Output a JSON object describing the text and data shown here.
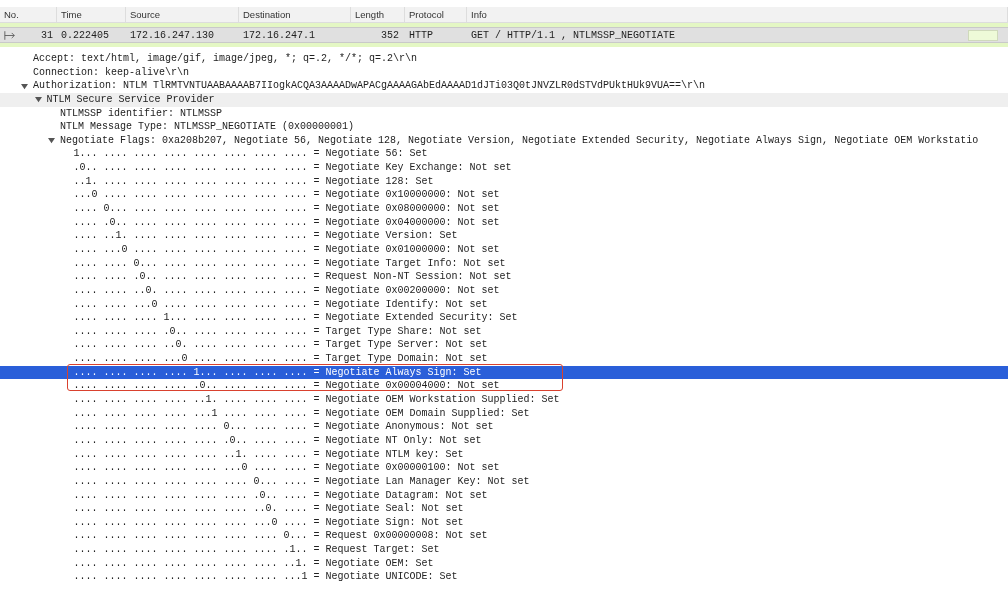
{
  "packet_list": {
    "columns": [
      "No.",
      "Time",
      "Source",
      "Destination",
      "Length",
      "Protocol",
      "Info"
    ],
    "rows": [
      {
        "no": "31",
        "time": "0.222405",
        "source": "172.16.247.130",
        "destination": "172.16.247.1",
        "length": "352",
        "protocol": "HTTP",
        "info": "GET / HTTP/1.1 , NTLMSSP_NEGOTIATE",
        "selected": true
      }
    ]
  },
  "details": {
    "items": [
      {
        "text": "Accept: text/html, image/gif, image/jpeg, *; q=.2, */*; q=.2\\r\\n",
        "selected": false
      },
      {
        "text": "Connection: keep-alive\\r\\n",
        "selected": false
      },
      {
        "text": "Authorization: NTLM TlRMTVNTUAABAAAAB7IIogkACQA3AAAADwAPACgAAAAGAbEdAAAAD1dJTi03Q0tJNVZLR0dSTVdPUktHUk9VUA==\\r\\n",
        "selected": false,
        "expanded": true,
        "children": [
          {
            "text": "NTLM Secure Service Provider",
            "selected": false,
            "shaded": true,
            "expanded": true,
            "children": [
              {
                "text": "NTLMSSP identifier: NTLMSSP",
                "selected": false
              },
              {
                "text": "NTLM Message Type: NTLMSSP_NEGOTIATE (0x00000001)",
                "selected": false
              },
              {
                "text": "Negotiate Flags: 0xa208b207, Negotiate 56, Negotiate 128, Negotiate Version, Negotiate Extended Security, Negotiate Always Sign, Negotiate OEM Workstatio",
                "selected": false,
                "expanded": true,
                "children": [
                  {
                    "text": "1... .... .... .... .... .... .... .... = Negotiate 56: Set",
                    "selected": false
                  },
                  {
                    "text": ".0.. .... .... .... .... .... .... .... = Negotiate Key Exchange: Not set",
                    "selected": false
                  },
                  {
                    "text": "..1. .... .... .... .... .... .... .... = Negotiate 128: Set",
                    "selected": false
                  },
                  {
                    "text": "...0 .... .... .... .... .... .... .... = Negotiate 0x10000000: Not set",
                    "selected": false
                  },
                  {
                    "text": ".... 0... .... .... .... .... .... .... = Negotiate 0x08000000: Not set",
                    "selected": false
                  },
                  {
                    "text": ".... .0.. .... .... .... .... .... .... = Negotiate 0x04000000: Not set",
                    "selected": false
                  },
                  {
                    "text": ".... ..1. .... .... .... .... .... .... = Negotiate Version: Set",
                    "selected": false
                  },
                  {
                    "text": ".... ...0 .... .... .... .... .... .... = Negotiate 0x01000000: Not set",
                    "selected": false
                  },
                  {
                    "text": ".... .... 0... .... .... .... .... .... = Negotiate Target Info: Not set",
                    "selected": false
                  },
                  {
                    "text": ".... .... .0.. .... .... .... .... .... = Request Non-NT Session: Not set",
                    "selected": false
                  },
                  {
                    "text": ".... .... ..0. .... .... .... .... .... = Negotiate 0x00200000: Not set",
                    "selected": false
                  },
                  {
                    "text": ".... .... ...0 .... .... .... .... .... = Negotiate Identify: Not set",
                    "selected": false
                  },
                  {
                    "text": ".... .... .... 1... .... .... .... .... = Negotiate Extended Security: Set",
                    "selected": false
                  },
                  {
                    "text": ".... .... .... .0.. .... .... .... .... = Target Type Share: Not set",
                    "selected": false
                  },
                  {
                    "text": ".... .... .... ..0. .... .... .... .... = Target Type Server: Not set",
                    "selected": false
                  },
                  {
                    "text": ".... .... .... ...0 .... .... .... .... = Target Type Domain: Not set",
                    "selected": false
                  },
                  {
                    "text": ".... .... .... .... 1... .... .... .... = Negotiate Always Sign: Set",
                    "selected": true
                  },
                  {
                    "text": ".... .... .... .... .0.. .... .... .... = Negotiate 0x00004000: Not set",
                    "selected": false
                  },
                  {
                    "text": ".... .... .... .... ..1. .... .... .... = Negotiate OEM Workstation Supplied: Set",
                    "selected": false
                  },
                  {
                    "text": ".... .... .... .... ...1 .... .... .... = Negotiate OEM Domain Supplied: Set",
                    "selected": false
                  },
                  {
                    "text": ".... .... .... .... .... 0... .... .... = Negotiate Anonymous: Not set",
                    "selected": false
                  },
                  {
                    "text": ".... .... .... .... .... .0.. .... .... = Negotiate NT Only: Not set",
                    "selected": false
                  },
                  {
                    "text": ".... .... .... .... .... ..1. .... .... = Negotiate NTLM key: Set",
                    "selected": false
                  },
                  {
                    "text": ".... .... .... .... .... ...0 .... .... = Negotiate 0x00000100: Not set",
                    "selected": false
                  },
                  {
                    "text": ".... .... .... .... .... .... 0... .... = Negotiate Lan Manager Key: Not set",
                    "selected": false
                  },
                  {
                    "text": ".... .... .... .... .... .... .0.. .... = Negotiate Datagram: Not set",
                    "selected": false
                  },
                  {
                    "text": ".... .... .... .... .... .... ..0. .... = Negotiate Seal: Not set",
                    "selected": false
                  },
                  {
                    "text": ".... .... .... .... .... .... ...0 .... = Negotiate Sign: Not set",
                    "selected": false
                  },
                  {
                    "text": ".... .... .... .... .... .... .... 0... = Request 0x00000008: Not set",
                    "selected": false
                  },
                  {
                    "text": ".... .... .... .... .... .... .... .1.. = Request Target: Set",
                    "selected": false
                  },
                  {
                    "text": ".... .... .... .... .... .... .... ..1. = Negotiate OEM: Set",
                    "selected": false
                  },
                  {
                    "text": ".... .... .... .... .... .... .... ...1 = Negotiate UNICODE: Set",
                    "selected": false
                  }
                ]
              }
            ]
          }
        ]
      }
    ]
  }
}
